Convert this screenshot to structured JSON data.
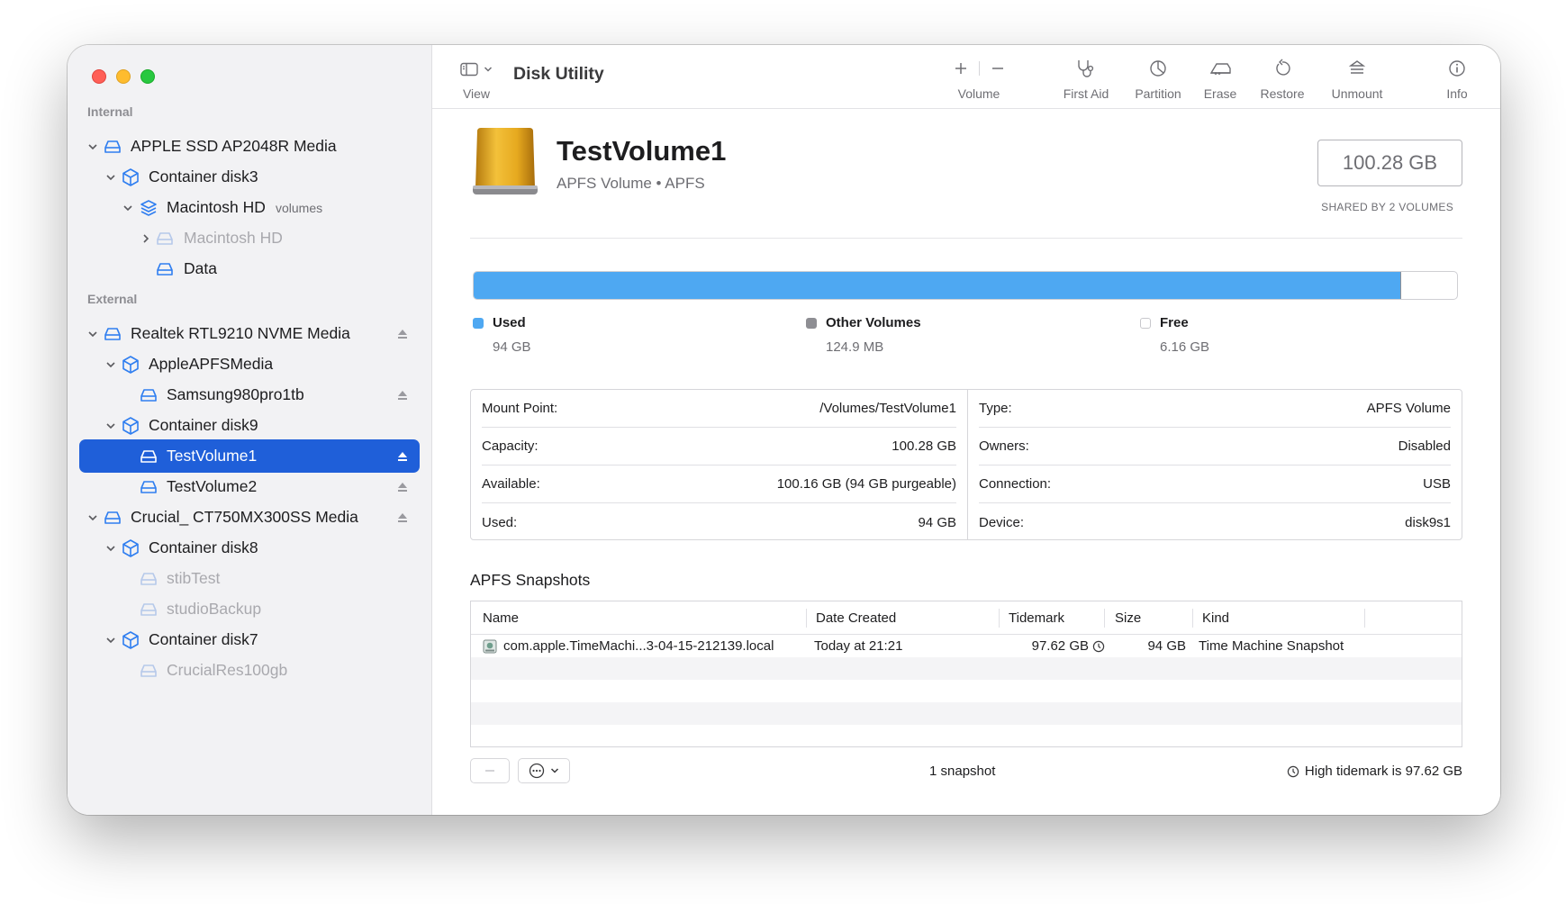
{
  "colors": {
    "used": "#4ea8f2",
    "other_volumes": "#8e8e93",
    "free": "#ffffff",
    "selection": "#1f5fd9",
    "sidebar_icon": "#2f7ef0"
  },
  "sidebar": {
    "internal_header": "Internal",
    "external_header": "External",
    "items": [
      {
        "label": "APPLE SSD AP2048R Media",
        "icon": "drive-icon",
        "level": 0,
        "disclosure": "expanded"
      },
      {
        "label": "Container disk3",
        "icon": "container-icon",
        "level": 1,
        "disclosure": "expanded"
      },
      {
        "label": "Macintosh HD",
        "sub": "volumes",
        "icon": "volume-group-icon",
        "level": 2,
        "disclosure": "expanded"
      },
      {
        "label": "Macintosh HD",
        "icon": "volume-icon",
        "level": 3,
        "disclosure": "collapsed",
        "dimmed": true
      },
      {
        "label": "Data",
        "icon": "volume-icon",
        "level": 3
      },
      {
        "label": "Realtek RTL9210 NVME Media",
        "icon": "drive-icon",
        "level": 0,
        "disclosure": "expanded",
        "eject": true
      },
      {
        "label": "AppleAPFSMedia",
        "icon": "container-icon",
        "level": 1,
        "disclosure": "expanded"
      },
      {
        "label": "Samsung980pro1tb",
        "icon": "volume-icon",
        "level": 2,
        "eject": true
      },
      {
        "label": "Container disk9",
        "icon": "container-icon",
        "level": 1,
        "disclosure": "expanded"
      },
      {
        "label": "TestVolume1",
        "icon": "volume-icon",
        "level": 2,
        "eject": true,
        "selected": true
      },
      {
        "label": "TestVolume2",
        "icon": "volume-icon",
        "level": 2,
        "eject": true
      },
      {
        "label": "Crucial_ CT750MX300SS Media",
        "icon": "drive-icon",
        "level": 0,
        "disclosure": "expanded",
        "eject": true
      },
      {
        "label": "Container disk8",
        "icon": "container-icon",
        "level": 1,
        "disclosure": "expanded"
      },
      {
        "label": "stibTest",
        "icon": "volume-icon",
        "level": 2,
        "dimmed": true
      },
      {
        "label": "studioBackup",
        "icon": "volume-icon",
        "level": 2,
        "dimmed": true
      },
      {
        "label": "Container disk7",
        "icon": "container-icon",
        "level": 1,
        "disclosure": "expanded"
      },
      {
        "label": "CrucialRes100gb",
        "icon": "volume-icon",
        "level": 2,
        "dimmed": true
      }
    ]
  },
  "toolbar": {
    "view_label": "View",
    "title": "Disk Utility",
    "volume_label": "Volume",
    "first_aid_label": "First Aid",
    "partition_label": "Partition",
    "erase_label": "Erase",
    "restore_label": "Restore",
    "unmount_label": "Unmount",
    "info_label": "Info"
  },
  "volume": {
    "name": "TestVolume1",
    "subtitle": "APFS Volume • APFS",
    "size": "100.28 GB",
    "size_caption": "SHARED BY 2 VOLUMES"
  },
  "usage": {
    "used_fraction": 0.942,
    "other_fraction": 0.0012,
    "used_label": "Used",
    "used_value": "94 GB",
    "other_label": "Other Volumes",
    "other_value": "124.9 MB",
    "free_label": "Free",
    "free_value": "6.16 GB"
  },
  "info": {
    "left": [
      {
        "key": "Mount Point:",
        "value": "/Volumes/TestVolume1"
      },
      {
        "key": "Capacity:",
        "value": "100.28 GB"
      },
      {
        "key": "Available:",
        "value": "100.16 GB (94 GB purgeable)"
      },
      {
        "key": "Used:",
        "value": "94 GB"
      }
    ],
    "right": [
      {
        "key": "Type:",
        "value": "APFS Volume"
      },
      {
        "key": "Owners:",
        "value": "Disabled"
      },
      {
        "key": "Connection:",
        "value": "USB"
      },
      {
        "key": "Device:",
        "value": "disk9s1"
      }
    ]
  },
  "snapshots": {
    "title": "APFS Snapshots",
    "columns": [
      "Name",
      "Date Created",
      "Tidemark",
      "Size",
      "Kind"
    ],
    "rows": [
      {
        "name": "com.apple.TimeMachi...3-04-15-212139.local",
        "date": "Today at 21:21",
        "tidemark": "97.62 GB",
        "size": "94 GB",
        "kind": "Time Machine Snapshot"
      }
    ],
    "count_label": "1 snapshot",
    "tidemark_note": "High tidemark is 97.62 GB"
  }
}
